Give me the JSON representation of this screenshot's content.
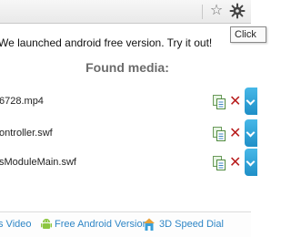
{
  "browser": {
    "bookmark_icon": "star-icon",
    "extension_icon": "gear-icon",
    "tooltip": "Click"
  },
  "popup": {
    "announcement": "We launched android free version. Try it out!",
    "found_title": "Found media:",
    "media": [
      {
        "name": "6728.mp4"
      },
      {
        "name": "ontroller.swf"
      },
      {
        "name": "sModuleMain.swf"
      }
    ],
    "footer": {
      "video_link": "s Video",
      "android_link": "Free Android Version",
      "dial_link": "3D Speed Dial"
    }
  },
  "colors": {
    "link": "#2f86c6",
    "delete": "#b81c1c",
    "download": "#2a9fd6",
    "title": "#6b6b6b"
  }
}
